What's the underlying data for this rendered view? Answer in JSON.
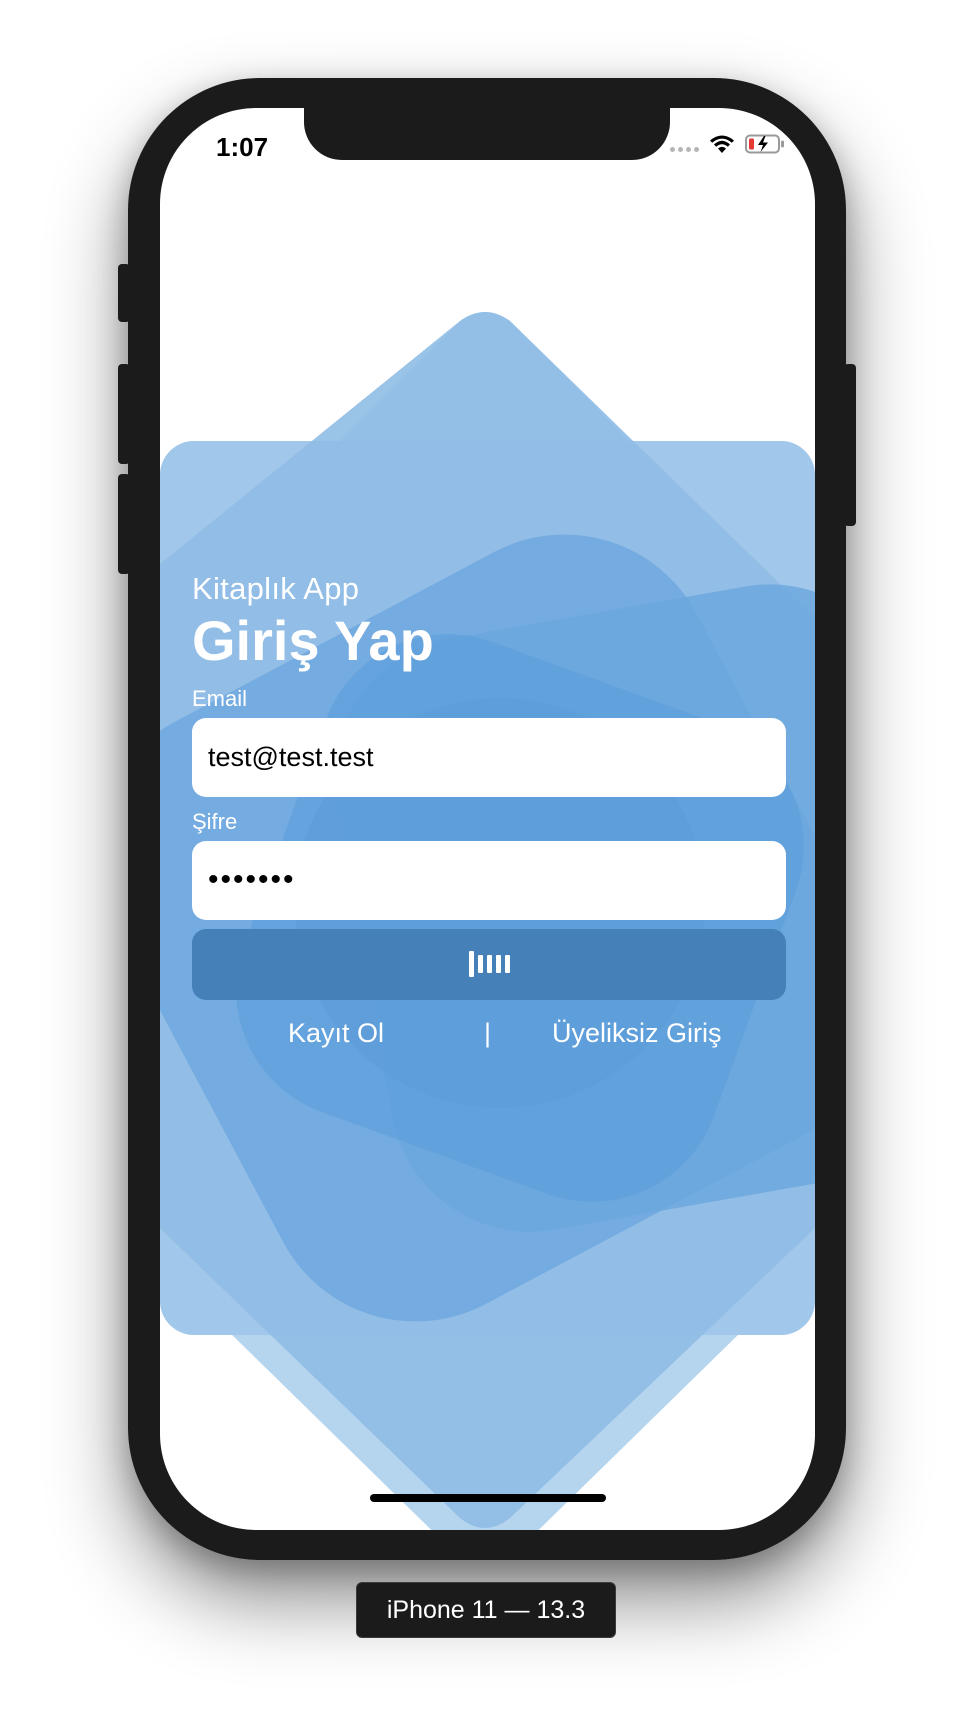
{
  "status_bar": {
    "time": "1:07",
    "icons": [
      "signal-dots-icon",
      "wifi-icon",
      "battery-charging-icon"
    ]
  },
  "login": {
    "subtitle": "Kitaplık App",
    "title": "Giriş Yap",
    "email_label": "Email",
    "email_value": "test@test.test",
    "password_label": "Şifre",
    "password_value": "•••••••",
    "button_state": "loading",
    "register_link": "Kayıt Ol",
    "separator": "|",
    "guest_link": "Üyeliksiz Giriş"
  },
  "device_label": "iPhone 11 — 13.3",
  "colors": {
    "accent_blue": "#5b9bd9",
    "button_blue": "#4580b8",
    "light_blue": "#b5d5ef"
  }
}
